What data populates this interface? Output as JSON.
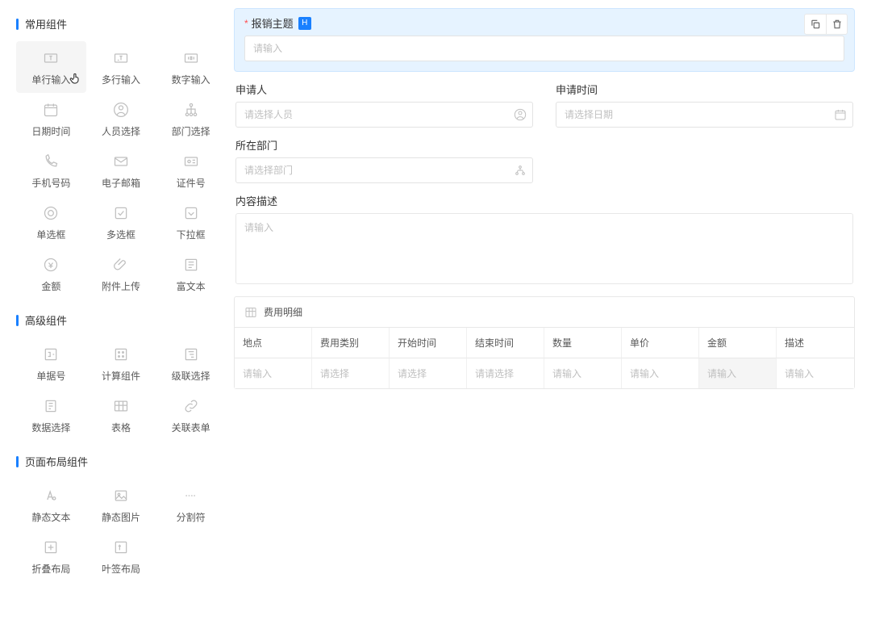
{
  "sidebar": {
    "sections": [
      {
        "title": "常用组件",
        "items": [
          {
            "label": "单行输入",
            "icon": "text-input-icon"
          },
          {
            "label": "多行输入",
            "icon": "textarea-icon"
          },
          {
            "label": "数字输入",
            "icon": "number-icon"
          },
          {
            "label": "日期时间",
            "icon": "calendar-icon"
          },
          {
            "label": "人员选择",
            "icon": "user-icon"
          },
          {
            "label": "部门选择",
            "icon": "org-icon"
          },
          {
            "label": "手机号码",
            "icon": "phone-icon"
          },
          {
            "label": "电子邮箱",
            "icon": "mail-icon"
          },
          {
            "label": "证件号",
            "icon": "id-icon"
          },
          {
            "label": "单选框",
            "icon": "radio-icon"
          },
          {
            "label": "多选框",
            "icon": "checkbox-icon"
          },
          {
            "label": "下拉框",
            "icon": "dropdown-icon"
          },
          {
            "label": "金额",
            "icon": "money-icon"
          },
          {
            "label": "附件上传",
            "icon": "attach-icon"
          },
          {
            "label": "富文本",
            "icon": "richtext-icon"
          }
        ]
      },
      {
        "title": "高级组件",
        "items": [
          {
            "label": "单据号",
            "icon": "docno-icon"
          },
          {
            "label": "计算组件",
            "icon": "calc-icon"
          },
          {
            "label": "级联选择",
            "icon": "cascade-icon"
          },
          {
            "label": "数据选择",
            "icon": "dataselect-icon"
          },
          {
            "label": "表格",
            "icon": "table-icon"
          },
          {
            "label": "关联表单",
            "icon": "link-icon"
          }
        ]
      },
      {
        "title": "页面布局组件",
        "items": [
          {
            "label": "静态文本",
            "icon": "statictext-icon"
          },
          {
            "label": "静态图片",
            "icon": "image-icon"
          },
          {
            "label": "分割符",
            "icon": "divider-icon"
          },
          {
            "label": "折叠布局",
            "icon": "collapse-icon"
          },
          {
            "label": "叶签布局",
            "icon": "tabs-icon"
          }
        ]
      }
    ]
  },
  "canvas": {
    "selected": {
      "title": "报销主题",
      "badge": "H",
      "placeholder": "请输入"
    },
    "fields": {
      "applicant": {
        "label": "申请人",
        "placeholder": "请选择人员"
      },
      "applyTime": {
        "label": "申请时间",
        "placeholder": "请选择日期"
      },
      "department": {
        "label": "所在部门",
        "placeholder": "请选择部门"
      },
      "description": {
        "label": "内容描述",
        "placeholder": "请输入"
      }
    },
    "table": {
      "caption": "费用明细",
      "headers": [
        "地点",
        "费用类别",
        "开始时间",
        "结束时间",
        "数量",
        "单价",
        "金额",
        "描述"
      ],
      "row": [
        "请输入",
        "请选择",
        "请选择",
        "请请选择",
        "请输入",
        "请输入",
        "请输入",
        "请输入"
      ],
      "highlightCol": 6
    }
  }
}
